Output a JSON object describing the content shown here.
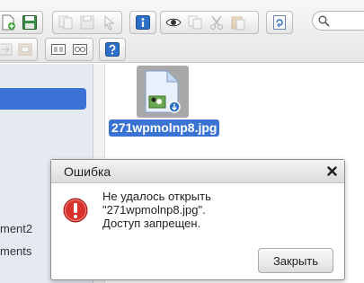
{
  "sidebar": {
    "items": [
      {
        "label": "ment2"
      },
      {
        "label": "ments"
      }
    ]
  },
  "search": {
    "placeholder": ""
  },
  "file": {
    "name": "271wpmolnp8.jpg"
  },
  "dialog": {
    "title": "Ошибка",
    "message_lines": [
      "Не удалось открыть",
      "\"271wpmolnp8.jpg\".",
      "Доступ запрещен."
    ],
    "close_label": "Закрыть"
  },
  "colors": {
    "selection": "#3b73d4",
    "error": "#d9312b",
    "info": "#2b6fc6"
  }
}
